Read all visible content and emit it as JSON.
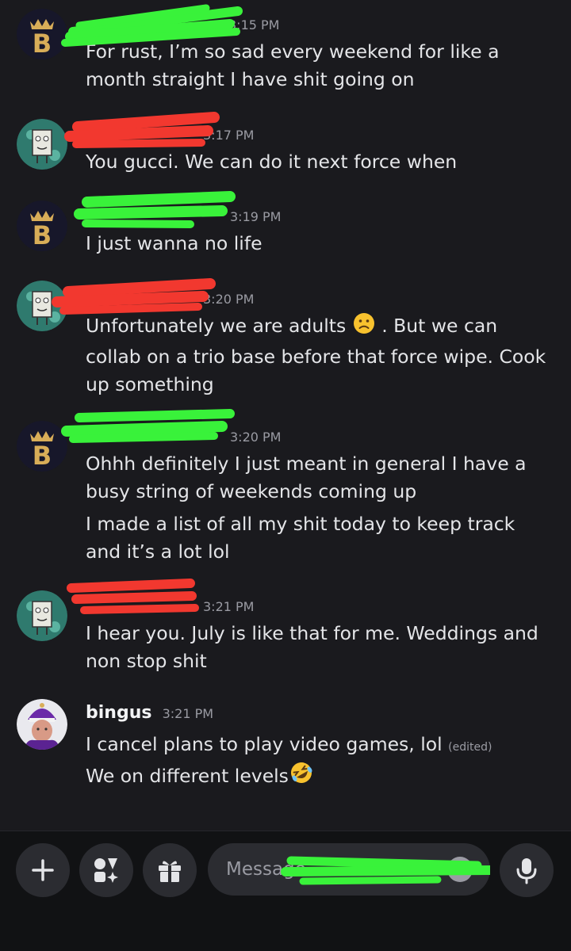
{
  "messages": [
    {
      "avatar": "crown-b-avatar",
      "username": "",
      "time": "3:15 PM",
      "lines": [
        "For rust, I’m so sad every weekend for like a month straight I have shit going on"
      ]
    },
    {
      "avatar": "doodlebob-avatar",
      "username": "",
      "time": "3:17 PM",
      "lines": [
        "You gucci. We can do it next force when"
      ]
    },
    {
      "avatar": "crown-b-avatar",
      "username": "",
      "time": "3:19 PM",
      "lines": [
        "I just wanna no life"
      ]
    },
    {
      "avatar": "doodlebob-avatar",
      "username": "",
      "time": "3:20 PM",
      "lines": [
        "Unfortunately we are adults",
        "slightly-frowning-face-emoji",
        ". But we can collab on a trio base before that force wipe. Cook up something"
      ]
    },
    {
      "avatar": "crown-b-avatar",
      "username": "",
      "time": "3:20 PM",
      "lines": [
        "Ohhh definitely I just meant in general I have a busy string of weekends coming up",
        "I made a list of all my shit today to keep track and it’s a lot lol"
      ]
    },
    {
      "avatar": "doodlebob-avatar",
      "username": "",
      "time": "3:21 PM",
      "lines": [
        "I hear you. July is like that for me. Weddings and non stop shit"
      ]
    },
    {
      "avatar": "king-avatar",
      "username": "bingus",
      "time": "3:21 PM",
      "lines": [
        "I cancel plans to play video games, lol",
        "We on different levels"
      ],
      "edited": "(edited)",
      "emoji": "rolling-on-floor-laughing-emoji"
    }
  ],
  "composer": {
    "placeholder": "Message",
    "buttons": [
      "plus-icon",
      "apps-icon",
      "gift-icon",
      "mic-icon"
    ]
  },
  "colors": {
    "background": "#1a1a1e",
    "bar": "#111214",
    "redact_green": "#39f23a",
    "redact_red": "#f2382f",
    "crown_gold": "#d8ad58"
  }
}
